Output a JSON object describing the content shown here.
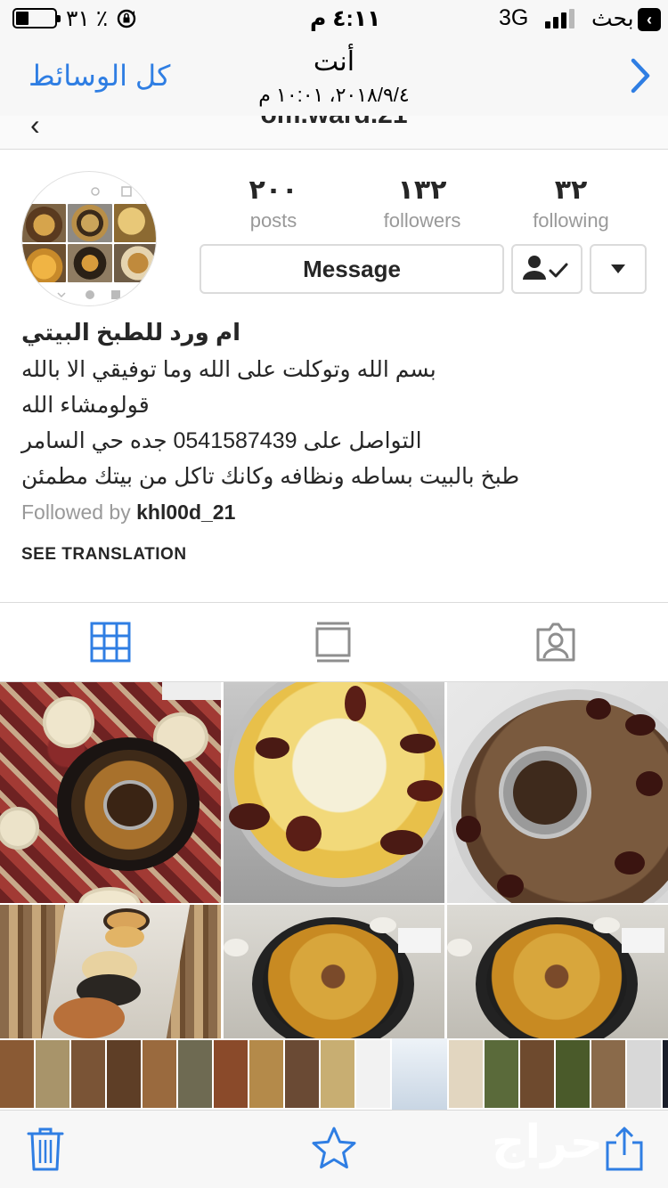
{
  "status_bar": {
    "battery_percent": "٣١ ٪",
    "time": "٤:١١ م",
    "network": "3G",
    "carrier": "بحث",
    "battery_level": 0.31
  },
  "nav": {
    "back_album": "كل الوسائط",
    "title": "أنت",
    "date": "٢٠١٨/٩/٤، ١٠:٠١ م"
  },
  "ig_header": {
    "username": "om.ward.21"
  },
  "profile": {
    "stats": [
      {
        "value": "٢٠٠",
        "label": "posts"
      },
      {
        "value": "١٣٢",
        "label": "followers"
      },
      {
        "value": "٣٢",
        "label": "following"
      }
    ],
    "message_label": "Message",
    "name": "ام ورد للطبخ البيتي",
    "bio_lines": [
      "بسم الله وتوكلت على الله وما توفيقي الا بالله",
      "قولومشاء الله",
      "التواصل على 0541587439 جده حي السامر",
      "طبخ بالبيت بساطه ونظافه وكانك تاكل من بيتك مطمئن"
    ],
    "followed_by_prefix": "Followed by",
    "followed_by_user": "khl00d_21",
    "see_translation": "SEE TRANSLATION"
  },
  "tabs": [
    {
      "icon": "grid-icon",
      "active": true
    },
    {
      "icon": "feed-icon",
      "active": false
    },
    {
      "icon": "tagged-icon",
      "active": false
    }
  ],
  "toolbar": {
    "watermark": "حراج"
  },
  "colors": {
    "ios_blue": "#2f7ee3",
    "ig_text": "#262626",
    "ig_muted": "#999999",
    "ig_border": "#dbdbdb"
  }
}
